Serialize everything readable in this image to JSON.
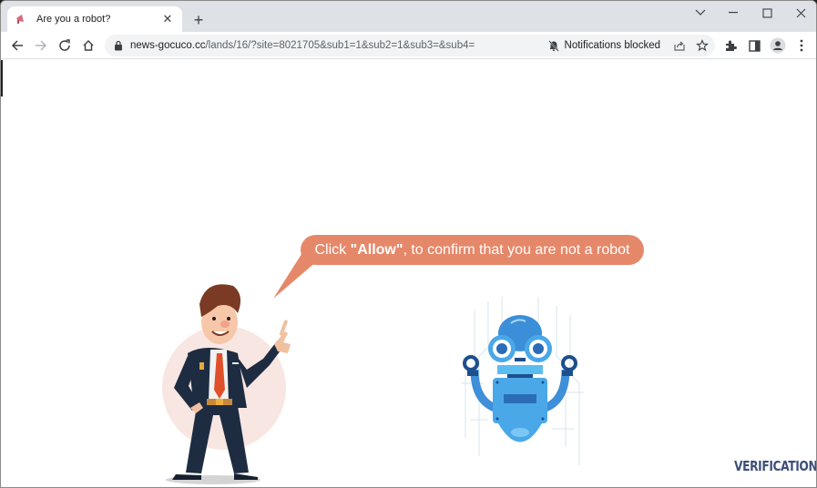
{
  "browser": {
    "tab": {
      "title": "Are you a robot?",
      "favicon": "megaphone-icon",
      "close_icon": "close-icon"
    },
    "new_tab_icon": "plus-icon",
    "window_controls": [
      "chevron-down-icon",
      "minimize-icon",
      "maximize-icon",
      "close-icon"
    ],
    "nav": {
      "back_icon": "arrow-left-icon",
      "forward_icon": "arrow-right-icon",
      "reload_icon": "reload-icon",
      "home_icon": "home-icon"
    },
    "omnibox": {
      "domain": "news-gocuco.cc",
      "path": "/lands/16/?site=8021705&sub1=1&sub2=1&sub3=&sub4=",
      "notification_status": "Notifications blocked"
    },
    "toolbar_icons": [
      "share-icon",
      "star-icon",
      "extensions-icon",
      "side-panel-icon",
      "profile-icon",
      "more-menu-icon"
    ]
  },
  "page": {
    "bubble": {
      "prefix": "Click ",
      "emphasis": "\"Allow\"",
      "suffix": ", to confirm that you are not a robot"
    },
    "logo_text": "VERIFICATION",
    "colors": {
      "bubble": "#e5886a",
      "logo": "#3c4e7a",
      "robot": "#4aa8e8"
    }
  }
}
